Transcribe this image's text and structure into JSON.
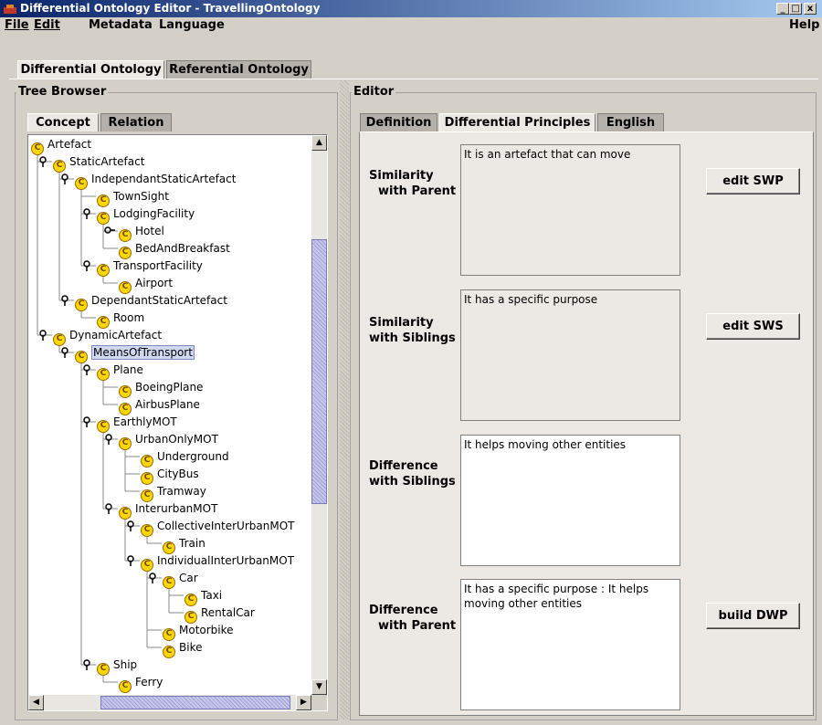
{
  "window": {
    "title": "Differential Ontology Editor - TravellingOntology",
    "min": "_",
    "max": "□",
    "close": "x"
  },
  "menu": {
    "file": "File",
    "edit": "Edit",
    "metadata": "Metadata",
    "language": "Language",
    "help": "Help"
  },
  "main_tabs": {
    "differential": "Differential Ontology",
    "referential": "Referential Ontology"
  },
  "tree_browser": {
    "title": "Tree Browser",
    "tabs": {
      "concept": "Concept",
      "relation": "Relation"
    },
    "concept_glyph": "C",
    "nodes": [
      {
        "label": "Artefact",
        "depth": 0,
        "handle": ""
      },
      {
        "label": "StaticArtefact",
        "depth": 1,
        "handle": "open"
      },
      {
        "label": "IndependantStaticArtefact",
        "depth": 2,
        "handle": "open"
      },
      {
        "label": "TownSight",
        "depth": 3,
        "handle": "leaf"
      },
      {
        "label": "LodgingFacility",
        "depth": 3,
        "handle": "open"
      },
      {
        "label": "Hotel",
        "depth": 4,
        "handle": "closed"
      },
      {
        "label": "BedAndBreakfast",
        "depth": 4,
        "handle": "leaf"
      },
      {
        "label": "TransportFacility",
        "depth": 3,
        "handle": "open"
      },
      {
        "label": "Airport",
        "depth": 4,
        "handle": "leaf"
      },
      {
        "label": "DependantStaticArtefact",
        "depth": 2,
        "handle": "open"
      },
      {
        "label": "Room",
        "depth": 3,
        "handle": "leaf"
      },
      {
        "label": "DynamicArtefact",
        "depth": 1,
        "handle": "open"
      },
      {
        "label": "MeansOfTransport",
        "depth": 2,
        "handle": "open",
        "selected": true
      },
      {
        "label": "Plane",
        "depth": 3,
        "handle": "open"
      },
      {
        "label": "BoeingPlane",
        "depth": 4,
        "handle": "leaf"
      },
      {
        "label": "AirbusPlane",
        "depth": 4,
        "handle": "leaf"
      },
      {
        "label": "EarthlyMOT",
        "depth": 3,
        "handle": "open"
      },
      {
        "label": "UrbanOnlyMOT",
        "depth": 4,
        "handle": "open"
      },
      {
        "label": "Underground",
        "depth": 5,
        "handle": "leaf"
      },
      {
        "label": "CityBus",
        "depth": 5,
        "handle": "leaf"
      },
      {
        "label": "Tramway",
        "depth": 5,
        "handle": "leaf"
      },
      {
        "label": "InterurbanMOT",
        "depth": 4,
        "handle": "open"
      },
      {
        "label": "CollectiveInterUrbanMOT",
        "depth": 5,
        "handle": "open"
      },
      {
        "label": "Train",
        "depth": 6,
        "handle": "leaf"
      },
      {
        "label": "IndividualInterUrbanMOT",
        "depth": 5,
        "handle": "open"
      },
      {
        "label": "Car",
        "depth": 6,
        "handle": "open"
      },
      {
        "label": "Taxi",
        "depth": 7,
        "handle": "leaf"
      },
      {
        "label": "RentalCar",
        "depth": 7,
        "handle": "leaf"
      },
      {
        "label": "Motorbike",
        "depth": 6,
        "handle": "leaf"
      },
      {
        "label": "Bike",
        "depth": 6,
        "handle": "leaf"
      },
      {
        "label": "Ship",
        "depth": 3,
        "handle": "open"
      },
      {
        "label": "Ferry",
        "depth": 4,
        "handle": "leaf"
      }
    ]
  },
  "editor": {
    "title": "Editor",
    "tabs": {
      "definition": "Definition",
      "principles": "Differential Principles",
      "english": "English"
    },
    "fields": [
      {
        "label_line1": "Similarity",
        "label_line2": "with Parent :",
        "text": "It is an artefact that can move",
        "editable": false,
        "button": "edit SWP"
      },
      {
        "label_line1": "Similarity",
        "label_line2": "with Siblings :",
        "text": "It has a specific purpose",
        "editable": false,
        "button": "edit SWS"
      },
      {
        "label_line1": "Difference",
        "label_line2": "with Siblings :",
        "text": "It helps moving other entities",
        "editable": true,
        "button": ""
      },
      {
        "label_line1": "Difference",
        "label_line2": "with Parent :",
        "text": "It has a specific purpose : It helps moving other entities",
        "editable": true,
        "button": "build DWP"
      }
    ]
  }
}
